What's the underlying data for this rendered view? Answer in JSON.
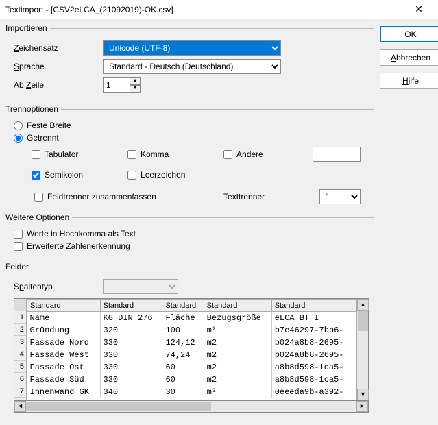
{
  "title": "Textimport - [CSV2eLCA_(21092019)-OK.csv]",
  "buttons": {
    "ok": "OK",
    "cancel": "Abbrechen",
    "help": "Hilfe"
  },
  "import": {
    "legend": "Importieren",
    "charset_label": "Zeichensatz",
    "charset_value": "Unicode (UTF-8)",
    "language_label": "Sprache",
    "language_value": "Standard - Deutsch (Deutschland)",
    "fromrow_label": "Ab Zeile",
    "fromrow_value": "1"
  },
  "sep": {
    "legend": "Trennoptionen",
    "fixed": "Feste Breite",
    "delimited": "Getrennt",
    "tab": "Tabulator",
    "comma": "Komma",
    "other": "Andere",
    "other_value": "",
    "semicolon": "Semikolon",
    "space": "Leerzeichen",
    "merge": "Feldtrenner zusammenfassen",
    "texttrenner": "Texttrenner",
    "texttrenner_value": "\""
  },
  "more": {
    "legend": "Weitere Optionen",
    "quoted": "Werte in Hochkomma als Text",
    "numdetect": "Erweiterte Zahlenerkennung"
  },
  "fields": {
    "legend": "Felder",
    "coltype_label": "Spaltentyp",
    "coltype_value": "",
    "headers": [
      "Standard",
      "Standard",
      "Standard",
      "Standard",
      "Standard"
    ],
    "rows": [
      [
        "Name",
        "KG DIN 276",
        "Fläche",
        "Bezugsgröße",
        "eLCA BT I"
      ],
      [
        "Gründung",
        "320",
        "100",
        "m²",
        "b7e46297-7bb6-"
      ],
      [
        "Fassade Nord",
        "330",
        "124,12",
        "m2",
        "b024a8b8-2695-"
      ],
      [
        "Fassade West",
        "330",
        "74,24",
        "m2",
        "b024a8b8-2695-"
      ],
      [
        "Fassade Ost",
        "330",
        "60",
        "m2",
        "a8b8d598-1ca5-"
      ],
      [
        "Fassade Süd",
        "330",
        "60",
        "m2",
        "a8b8d598-1ca5-"
      ],
      [
        "Innenwand GK",
        "340",
        "30",
        "m²",
        "0eeeda9b-a392-"
      ]
    ]
  }
}
